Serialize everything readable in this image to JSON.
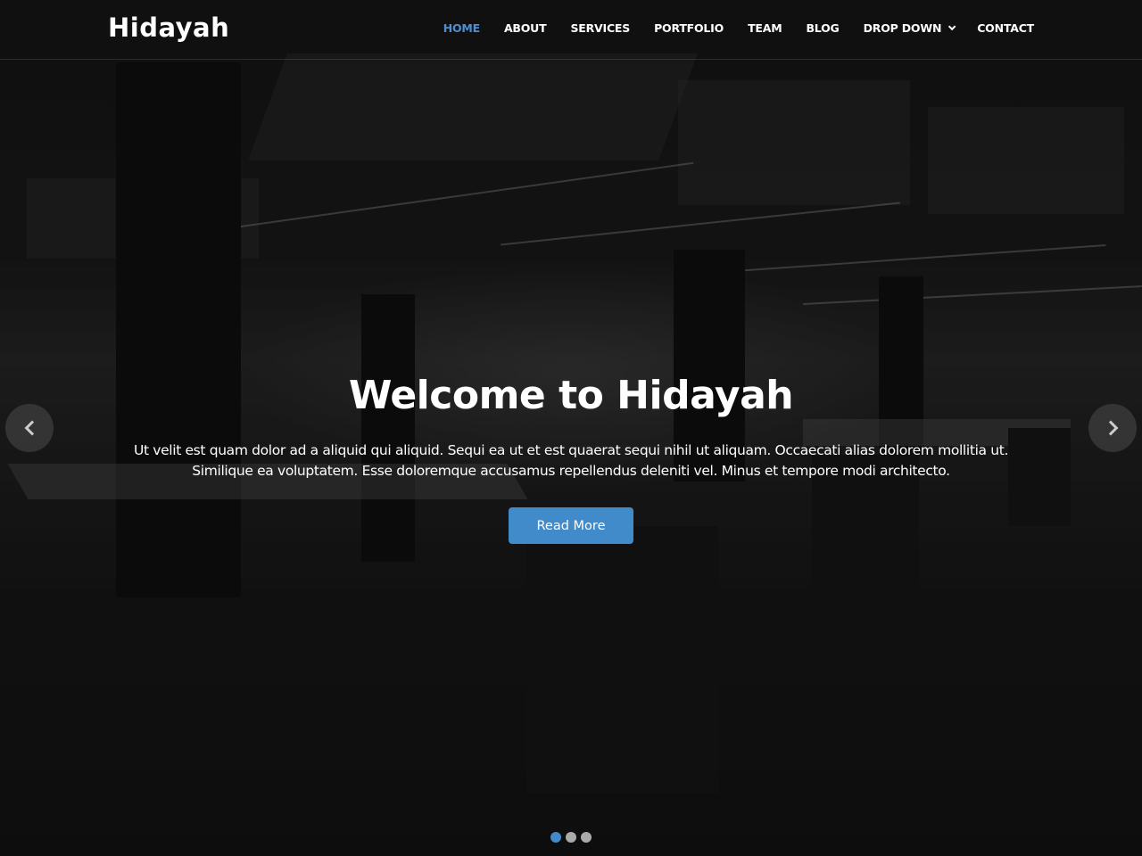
{
  "brand": {
    "logo": "Hidayah"
  },
  "nav": {
    "items": [
      {
        "label": "HOME",
        "active": true
      },
      {
        "label": "ABOUT"
      },
      {
        "label": "SERVICES"
      },
      {
        "label": "PORTFOLIO"
      },
      {
        "label": "TEAM"
      },
      {
        "label": "BLOG"
      },
      {
        "label": "DROP DOWN",
        "icon": "chevron-down-icon"
      },
      {
        "label": "CONTACT"
      }
    ]
  },
  "hero": {
    "title": "Welcome to Hidayah",
    "description": "Ut velit est quam dolor ad a aliquid qui aliquid. Sequi ea ut et est quaerat sequi nihil ut aliquam. Occaecati alias dolorem mollitia ut. Similique ea voluptatem. Esse doloremque accusamus repellendus deleniti vel. Minus et tempore modi architecto.",
    "button_label": "Read More",
    "prev_icon": "chevron-left-icon",
    "next_icon": "chevron-right-icon",
    "slides_total": 3,
    "active_slide": 1
  },
  "colors": {
    "accent": "#428bca",
    "nav_active": "#4d8fd6"
  }
}
